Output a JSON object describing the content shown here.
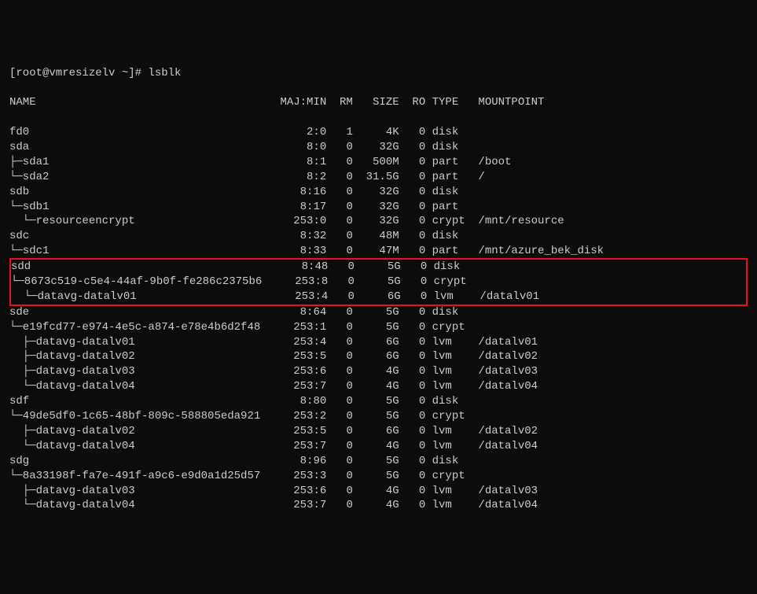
{
  "prompt": "[root@vmresizelv ~]# lsblk",
  "headers": {
    "name": "NAME",
    "majmin": "MAJ:MIN",
    "rm": "RM",
    "size": "SIZE",
    "ro": "RO",
    "type": "TYPE",
    "mountpoint": "MOUNTPOINT"
  },
  "rows": [
    {
      "name": "fd0",
      "majmin": "2:0",
      "rm": "1",
      "size": "4K",
      "ro": "0",
      "type": "disk",
      "mnt": ""
    },
    {
      "name": "sda",
      "majmin": "8:0",
      "rm": "0",
      "size": "32G",
      "ro": "0",
      "type": "disk",
      "mnt": ""
    },
    {
      "name": "├─sda1",
      "majmin": "8:1",
      "rm": "0",
      "size": "500M",
      "ro": "0",
      "type": "part",
      "mnt": "/boot"
    },
    {
      "name": "└─sda2",
      "majmin": "8:2",
      "rm": "0",
      "size": "31.5G",
      "ro": "0",
      "type": "part",
      "mnt": "/"
    },
    {
      "name": "sdb",
      "majmin": "8:16",
      "rm": "0",
      "size": "32G",
      "ro": "0",
      "type": "disk",
      "mnt": ""
    },
    {
      "name": "└─sdb1",
      "majmin": "8:17",
      "rm": "0",
      "size": "32G",
      "ro": "0",
      "type": "part",
      "mnt": ""
    },
    {
      "name": "  └─resourceencrypt",
      "majmin": "253:0",
      "rm": "0",
      "size": "32G",
      "ro": "0",
      "type": "crypt",
      "mnt": "/mnt/resource"
    },
    {
      "name": "sdc",
      "majmin": "8:32",
      "rm": "0",
      "size": "48M",
      "ro": "0",
      "type": "disk",
      "mnt": ""
    },
    {
      "name": "└─sdc1",
      "majmin": "8:33",
      "rm": "0",
      "size": "47M",
      "ro": "0",
      "type": "part",
      "mnt": "/mnt/azure_bek_disk"
    },
    {
      "name": "sdd",
      "majmin": "8:48",
      "rm": "0",
      "size": "5G",
      "ro": "0",
      "type": "disk",
      "mnt": "",
      "hl": true
    },
    {
      "name": "└─8673c519-c5e4-44af-9b0f-fe286c2375b6",
      "majmin": "253:8",
      "rm": "0",
      "size": "5G",
      "ro": "0",
      "type": "crypt",
      "mnt": "",
      "hl": true
    },
    {
      "name": "  └─datavg-datalv01",
      "majmin": "253:4",
      "rm": "0",
      "size": "6G",
      "ro": "0",
      "type": "lvm",
      "mnt": "/datalv01",
      "hl": true
    },
    {
      "name": "sde",
      "majmin": "8:64",
      "rm": "0",
      "size": "5G",
      "ro": "0",
      "type": "disk",
      "mnt": ""
    },
    {
      "name": "└─e19fcd77-e974-4e5c-a874-e78e4b6d2f48",
      "majmin": "253:1",
      "rm": "0",
      "size": "5G",
      "ro": "0",
      "type": "crypt",
      "mnt": ""
    },
    {
      "name": "  ├─datavg-datalv01",
      "majmin": "253:4",
      "rm": "0",
      "size": "6G",
      "ro": "0",
      "type": "lvm",
      "mnt": "/datalv01"
    },
    {
      "name": "  ├─datavg-datalv02",
      "majmin": "253:5",
      "rm": "0",
      "size": "6G",
      "ro": "0",
      "type": "lvm",
      "mnt": "/datalv02"
    },
    {
      "name": "  ├─datavg-datalv03",
      "majmin": "253:6",
      "rm": "0",
      "size": "4G",
      "ro": "0",
      "type": "lvm",
      "mnt": "/datalv03"
    },
    {
      "name": "  └─datavg-datalv04",
      "majmin": "253:7",
      "rm": "0",
      "size": "4G",
      "ro": "0",
      "type": "lvm",
      "mnt": "/datalv04"
    },
    {
      "name": "sdf",
      "majmin": "8:80",
      "rm": "0",
      "size": "5G",
      "ro": "0",
      "type": "disk",
      "mnt": ""
    },
    {
      "name": "└─49de5df0-1c65-48bf-809c-588805eda921",
      "majmin": "253:2",
      "rm": "0",
      "size": "5G",
      "ro": "0",
      "type": "crypt",
      "mnt": ""
    },
    {
      "name": "  ├─datavg-datalv02",
      "majmin": "253:5",
      "rm": "0",
      "size": "6G",
      "ro": "0",
      "type": "lvm",
      "mnt": "/datalv02"
    },
    {
      "name": "  └─datavg-datalv04",
      "majmin": "253:7",
      "rm": "0",
      "size": "4G",
      "ro": "0",
      "type": "lvm",
      "mnt": "/datalv04"
    },
    {
      "name": "sdg",
      "majmin": "8:96",
      "rm": "0",
      "size": "5G",
      "ro": "0",
      "type": "disk",
      "mnt": ""
    },
    {
      "name": "└─8a33198f-fa7e-491f-a9c6-e9d0a1d25d57",
      "majmin": "253:3",
      "rm": "0",
      "size": "5G",
      "ro": "0",
      "type": "crypt",
      "mnt": ""
    },
    {
      "name": "  ├─datavg-datalv03",
      "majmin": "253:6",
      "rm": "0",
      "size": "4G",
      "ro": "0",
      "type": "lvm",
      "mnt": "/datalv03"
    },
    {
      "name": "  └─datavg-datalv04",
      "majmin": "253:7",
      "rm": "0",
      "size": "4G",
      "ro": "0",
      "type": "lvm",
      "mnt": "/datalv04"
    }
  ]
}
